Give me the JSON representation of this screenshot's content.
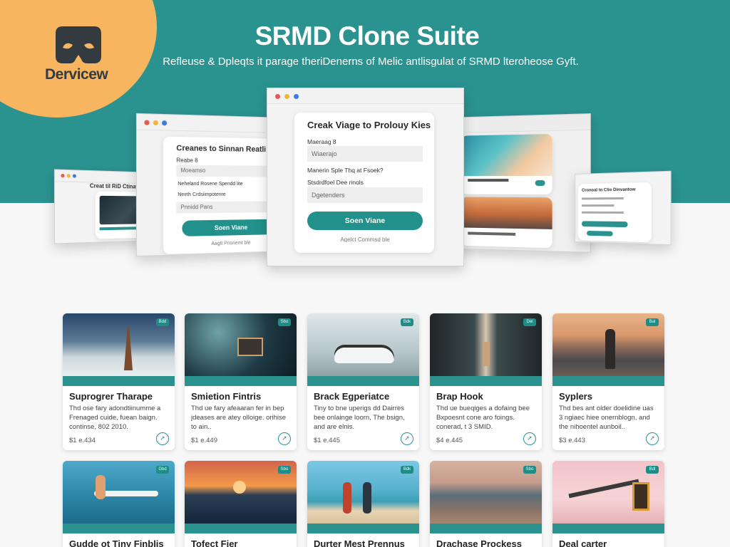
{
  "brand": {
    "name": "Dervicew"
  },
  "hero": {
    "title": "SRMD Clone Suite",
    "subtitle": "Refleuse & Dpleqts it parage theriDenerns of Melic antlisgulat of SRMD lteroheose Gyft."
  },
  "windows": {
    "main": {
      "title": "Creak Viage to Prolouy Kies",
      "field1_label": "Maeraag 8",
      "field1_value": "Wiaerajo",
      "option_text": "Manerin Sple Thq at Fsoek?",
      "field2_label": "Stsdrdfoel Dee rinols",
      "field2_value": "Dgetenders",
      "button": "Soen Viane",
      "link": "Aqelct Commsd ble"
    },
    "left": {
      "title": "Creanes to Sinnan Reatli",
      "field1_label": "Reabe 8",
      "field1_value": "Moeamso",
      "option1": "Neheland Rosene Spendd lite",
      "option2": "Neeth Crdsiimpotenre",
      "field2_value": "Pnnidd Pans",
      "button": "Soen Viane",
      "link": "Aagtt Pnsnemt ble"
    },
    "far_left": {
      "title": "Creat til RiD Ctinaw"
    },
    "far_right": {
      "title": "Cronoal to Clio Dinvantow"
    }
  },
  "cards": [
    {
      "title": "Suprogrer Tharape",
      "desc": "Thd ose fary adondtiinumme a Frenaged cuide, fuean baign. continse, 802 2010.",
      "price": "$1 e.434",
      "badge": "Bdd"
    },
    {
      "title": "Smietion Fintris",
      "desc": "Thd ue fary afeaaran fer in bep jdeases are atey olloige. orihise to ain..",
      "price": "$1 e.449",
      "badge": "Sbo"
    },
    {
      "title": "Brack Egperiatce",
      "desc": "Tiny to bne uperigs dd Dairres bee onlainge loorn, The bsign, and are elnis.",
      "price": "$1 e.445",
      "badge": "Bdk"
    },
    {
      "title": "Brap Hook",
      "desc": "Thd ue bueqiges a dofaing bee Bxpoesnt cone aro foings. conerad, t 3 SMID.",
      "price": "$4 e.445",
      "badge": "Dei"
    },
    {
      "title": "Syplers",
      "desc": "Thd bes ant older doelidine uas 3 ngiaec hiee onernblogn, and the nihoentel aunboil..",
      "price": "$3 e.443",
      "badge": "Bal"
    },
    {
      "title": "Gudde ot Tiny Finblis",
      "badge": "Gbd"
    },
    {
      "title": "Tofect Fier",
      "badge": "Sbo"
    },
    {
      "title": "Durter Mest Prennus",
      "badge": "Bdk"
    },
    {
      "title": "Drachase Prockess",
      "badge": "Sbo"
    },
    {
      "title": "Deal carter",
      "badge": "Bdl"
    }
  ],
  "colors": {
    "teal": "#2a9390",
    "orange": "#f6b55e",
    "button": "#22918b"
  }
}
